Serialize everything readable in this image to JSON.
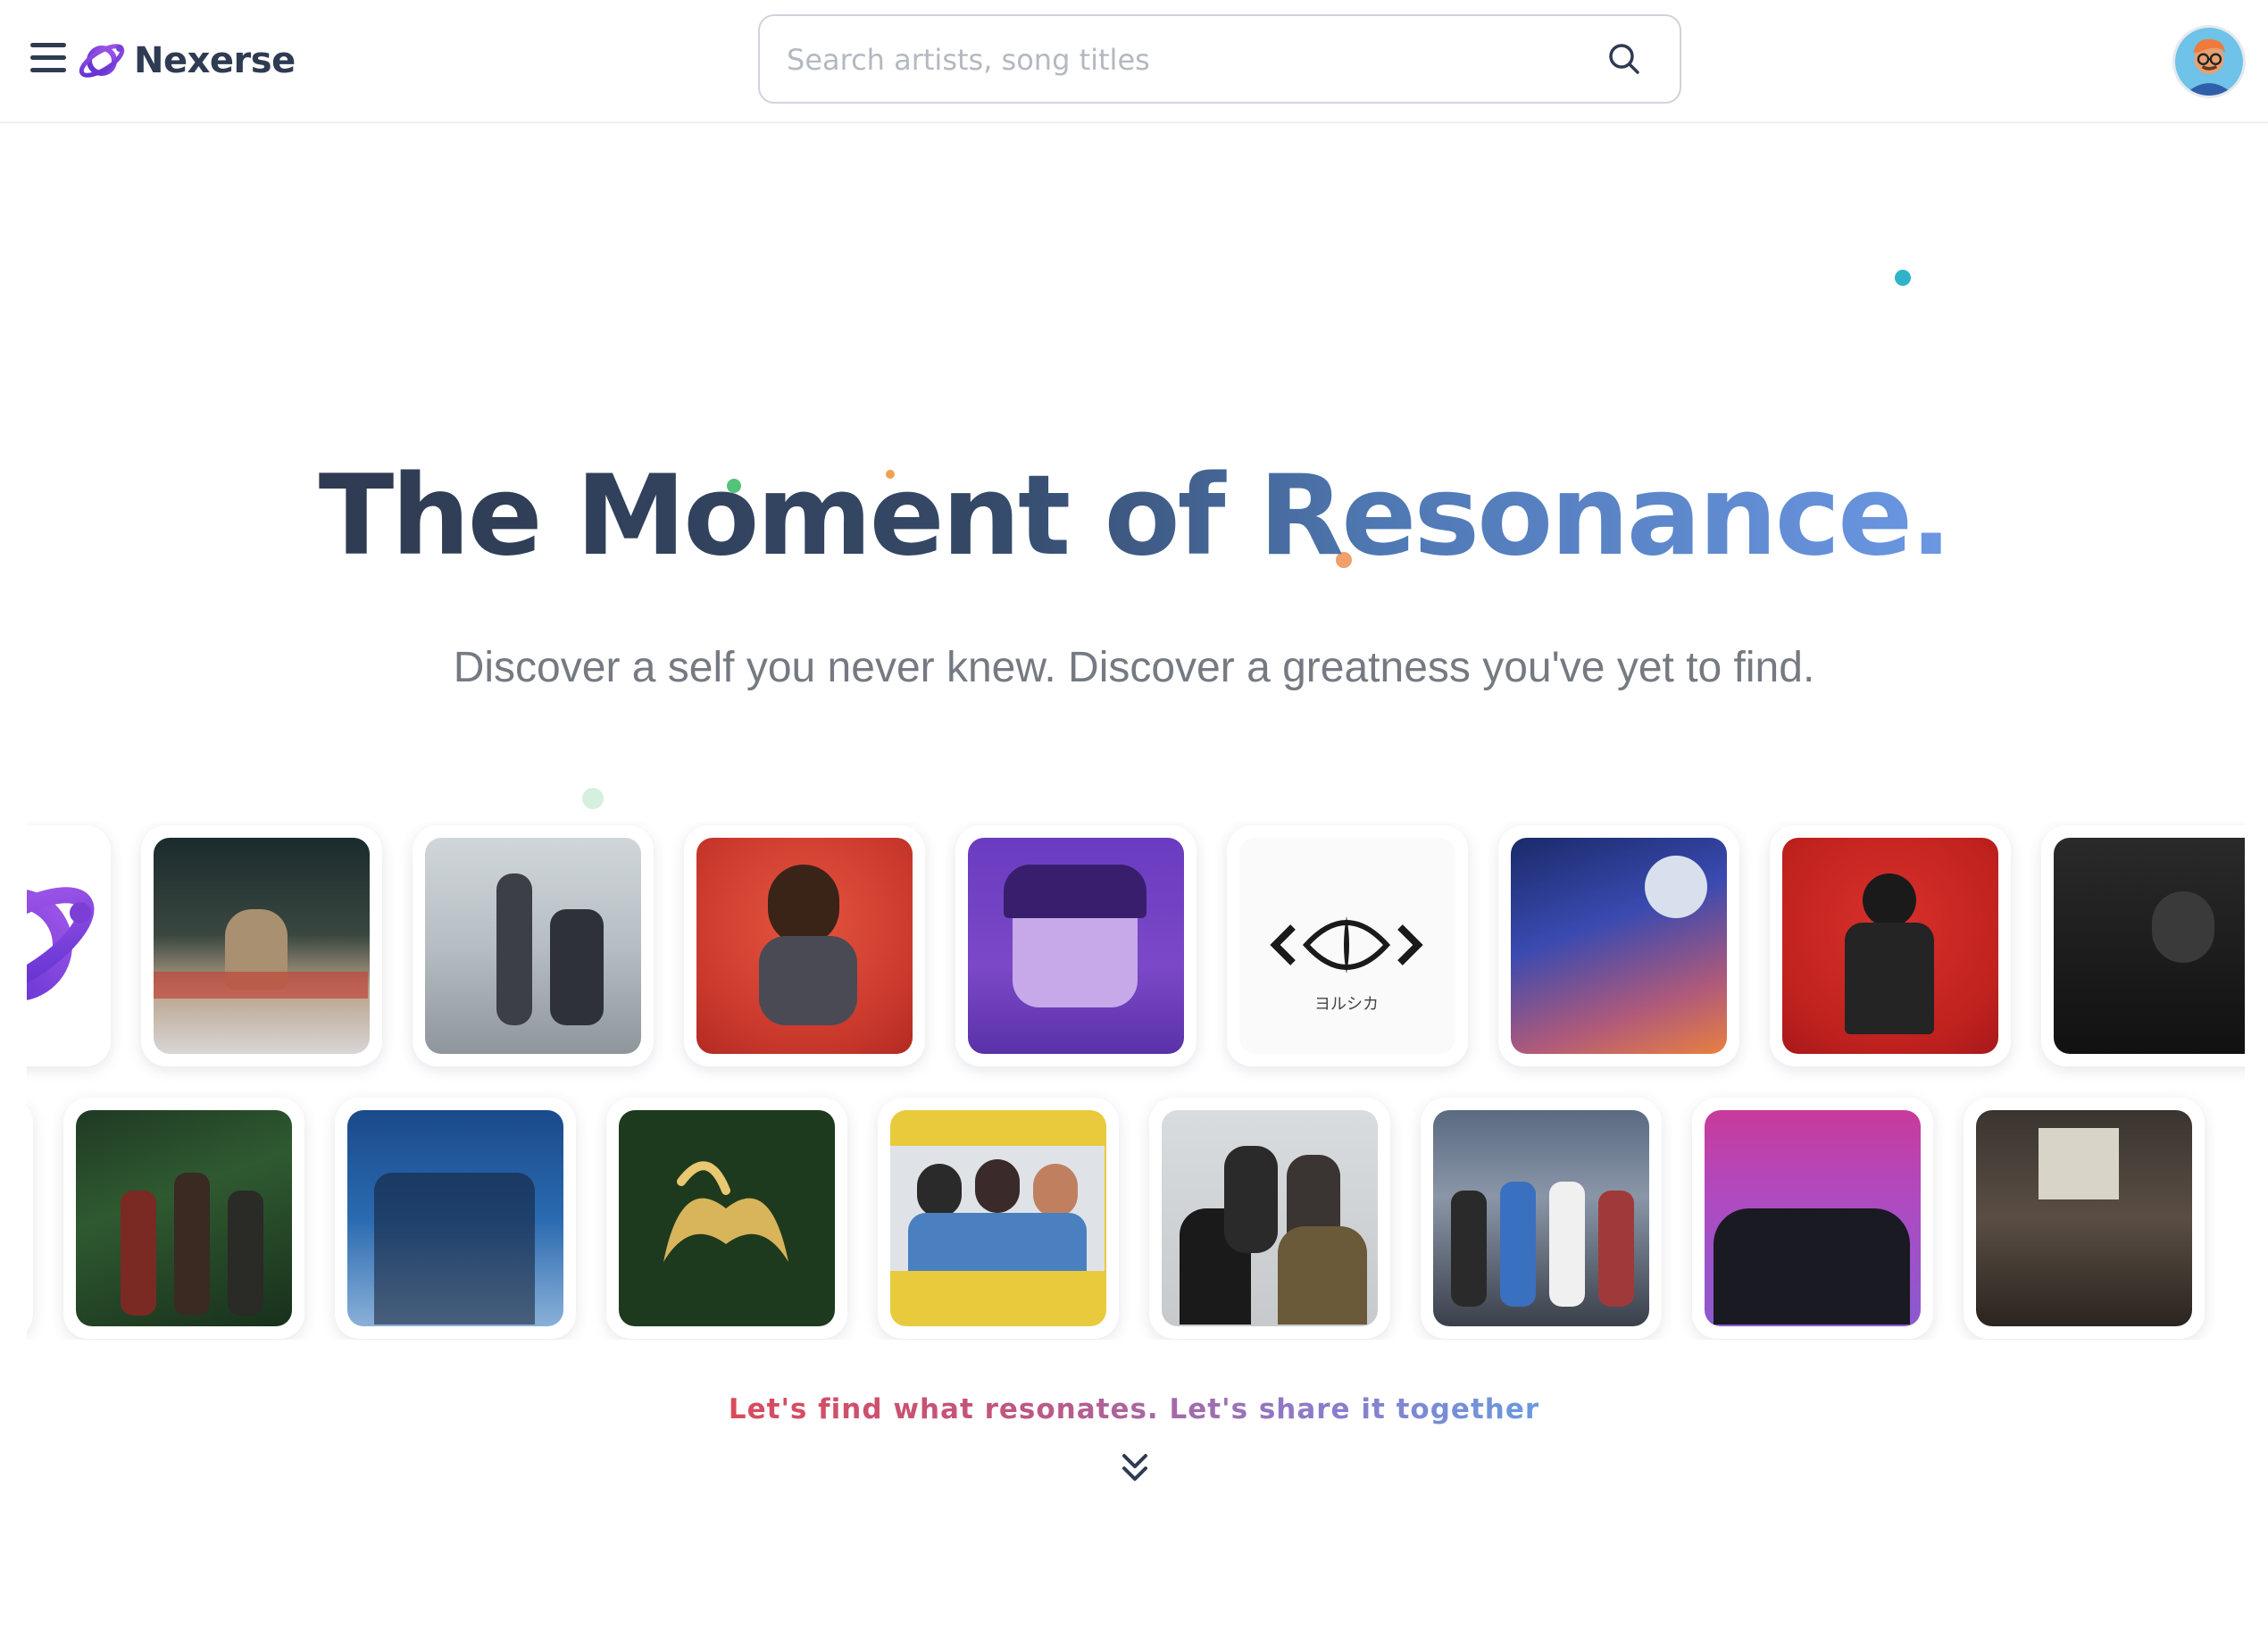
{
  "header": {
    "brand": "Nexerse",
    "menu_icon": "hamburger-menu-icon",
    "search": {
      "placeholder": "Search artists, song titles",
      "value": ""
    },
    "search_icon": "search-icon",
    "avatar_icon": "user-avatar-icon"
  },
  "hero": {
    "title": "The Moment of Resonance.",
    "subtitle": "Discover a self you never knew. Discover a greatness you've yet to find."
  },
  "carousel": {
    "row1": [
      "logo-planet",
      "night-rooftop",
      "office-duo",
      "red-portrait",
      "purple-anime",
      "eye-logo",
      "space-illustration",
      "red-masked",
      "dark-portrait"
    ],
    "row2": [
      "pale-portrait",
      "jungle-band",
      "blue-band",
      "gold-emblem",
      "yellow-trio",
      "group-photo",
      "rooftop-band",
      "pink-band",
      "living-room"
    ]
  },
  "cta": {
    "text": "Let's find what resonates. Let's share it together",
    "scroll_icon": "double-chevron-down-icon"
  },
  "colors": {
    "title_dark": "#2f3b52",
    "title_blue": "#6b97e3",
    "cta_red": "#d94b5c",
    "cta_blue": "#6a9ae0",
    "brand_purple": "#7b3fd6"
  }
}
